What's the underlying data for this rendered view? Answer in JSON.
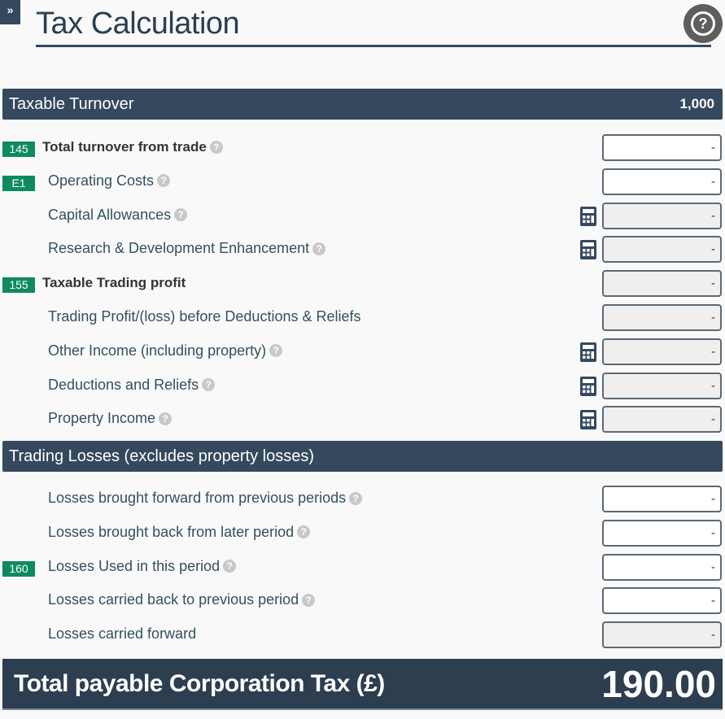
{
  "header": {
    "expand_icon": "»",
    "title": "Tax Calculation",
    "help_icon": "?"
  },
  "sections": {
    "taxable_turnover": {
      "title": "Taxable Turnover",
      "value": "1,000"
    },
    "trading_losses": {
      "title": "Trading Losses (excludes property losses)"
    }
  },
  "rows": [
    {
      "badge": "145",
      "label": "Total turnover from trade",
      "bold": true,
      "help": true,
      "calc": false,
      "value": "-",
      "disabled": false
    },
    {
      "badge": "E1",
      "label": "Operating Costs",
      "bold": false,
      "help": true,
      "calc": false,
      "value": "-",
      "disabled": false
    },
    {
      "badge": "",
      "label": "Capital Allowances",
      "bold": false,
      "help": true,
      "calc": true,
      "value": "-",
      "disabled": true
    },
    {
      "badge": "",
      "label": "Research & Development Enhancement",
      "bold": false,
      "help": true,
      "calc": true,
      "value": "-",
      "disabled": true
    },
    {
      "badge": "155",
      "label": "Taxable Trading profit",
      "bold": true,
      "help": false,
      "calc": false,
      "value": "-",
      "disabled": true
    },
    {
      "badge": "",
      "label": "Trading Profit/(loss) before Deductions & Reliefs",
      "bold": false,
      "help": false,
      "calc": false,
      "value": "-",
      "disabled": true
    },
    {
      "badge": "",
      "label": "Other Income (including property)",
      "bold": false,
      "help": true,
      "calc": true,
      "value": "-",
      "disabled": true
    },
    {
      "badge": "",
      "label": "Deductions and Reliefs",
      "bold": false,
      "help": true,
      "calc": true,
      "value": "-",
      "disabled": true
    },
    {
      "badge": "",
      "label": "Property Income",
      "bold": false,
      "help": true,
      "calc": true,
      "value": "-",
      "disabled": true
    }
  ],
  "loss_rows": [
    {
      "badge": "",
      "label": "Losses brought forward from previous periods",
      "help": true,
      "value": "-",
      "disabled": false
    },
    {
      "badge": "",
      "label": "Losses brought back from later period",
      "help": true,
      "value": "-",
      "disabled": false
    },
    {
      "badge": "160",
      "label": "Losses Used in this period",
      "help": true,
      "value": "-",
      "disabled": false
    },
    {
      "badge": "",
      "label": "Losses carried back to previous period",
      "help": true,
      "value": "-",
      "disabled": false
    },
    {
      "badge": "",
      "label": "Losses carried forward",
      "help": false,
      "value": "-",
      "disabled": true
    }
  ],
  "total": {
    "label": "Total payable Corporation Tax (£)",
    "value": "190.00"
  },
  "colors": {
    "header_bg": "#34495e",
    "badge_green": "#0e8a5f",
    "total_bg": "#2c3e50"
  }
}
